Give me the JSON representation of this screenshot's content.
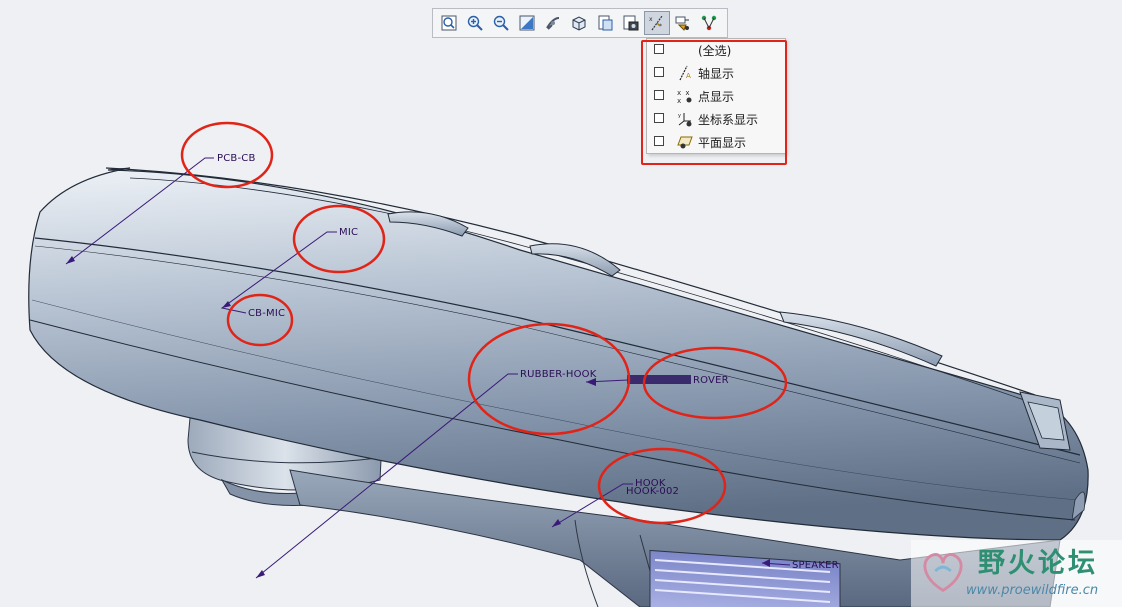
{
  "toolbar": {
    "buttons": [
      {
        "icon": "refit-icon"
      },
      {
        "icon": "zoom-in-icon"
      },
      {
        "icon": "zoom-out-icon"
      },
      {
        "icon": "repaint-icon"
      },
      {
        "icon": "spin-center-icon"
      },
      {
        "icon": "display-style-icon"
      },
      {
        "icon": "saved-views-icon"
      },
      {
        "icon": "view-manager-icon"
      },
      {
        "icon": "datum-display-filters-icon",
        "active": true
      },
      {
        "icon": "annotation-display-icon"
      },
      {
        "icon": "model-tree-display-icon"
      }
    ]
  },
  "datum_menu": {
    "items": [
      {
        "label": "(全选)",
        "icon": "",
        "checked": false
      },
      {
        "label": "轴显示",
        "icon": "axis-icon",
        "checked": false
      },
      {
        "label": "点显示",
        "icon": "point-icon",
        "checked": false
      },
      {
        "label": "坐标系显示",
        "icon": "csys-icon",
        "checked": false
      },
      {
        "label": "平面显示",
        "icon": "plane-icon",
        "checked": false
      }
    ]
  },
  "annotations": {
    "pcb_cb": "PCB-CB",
    "mic": "MIC",
    "cb_mic": "CB-MIC",
    "rubber_hook": "RUBBER-HOOK",
    "cover": "ROVER",
    "hook": "HOOK",
    "hook_002": "HOOK-002",
    "speaker": "SPEAKER"
  },
  "watermark": {
    "title": "野火论坛",
    "url": "www.proewildfire.cn"
  },
  "colors": {
    "highlight": "#e02418",
    "annotation": "#3a1a78",
    "model": "#8ea0b8"
  }
}
